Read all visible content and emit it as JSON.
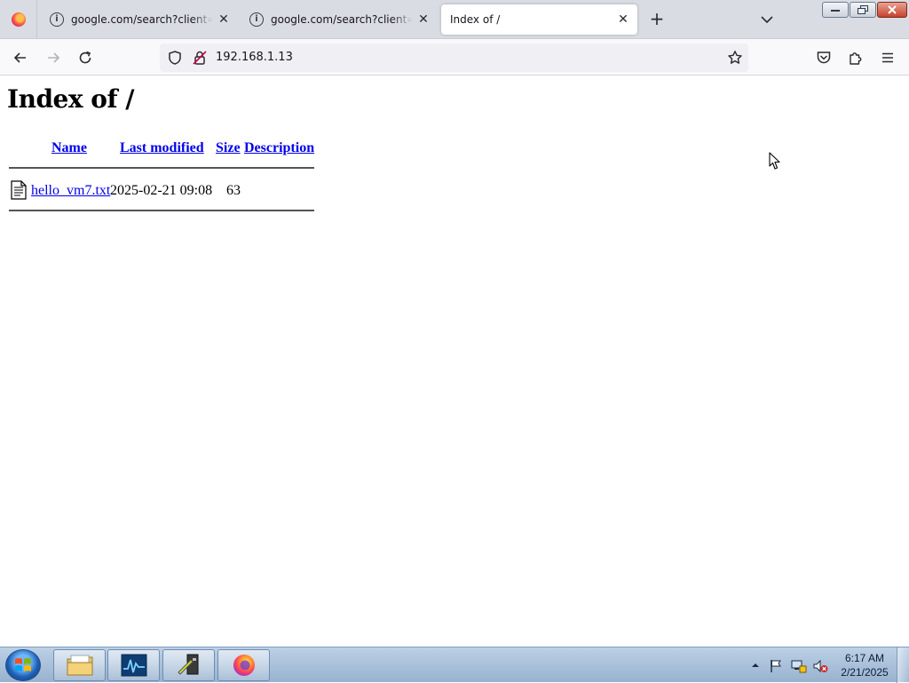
{
  "browser": {
    "tabs": [
      {
        "title": "google.com/search?client=firefox-b-d&q=",
        "active": false,
        "icon": "info-icon"
      },
      {
        "title": "google.com/search?client=firefox-b-d&q=",
        "active": false,
        "icon": "info-icon"
      },
      {
        "title": "Index of /",
        "active": true,
        "icon": ""
      }
    ],
    "new_tab_label": "+",
    "url": "192.168.1.13"
  },
  "page": {
    "title": "Index of /",
    "columns": {
      "name": "Name",
      "last_modified": "Last modified",
      "size": "Size",
      "description": "Description"
    },
    "files": [
      {
        "name": "hello_vm7.txt",
        "last_modified": "2025-02-21 09:08",
        "size": "63",
        "description": "",
        "icon": "text-file-icon"
      }
    ]
  },
  "taskbar": {
    "apps": [
      "file-explorer-icon",
      "resource-monitor-icon",
      "tools-app-icon",
      "firefox-icon"
    ],
    "clock": {
      "time": "6:17 AM",
      "date": "2/21/2025"
    },
    "tray": [
      "show-hidden-icons",
      "action-center-flag-icon",
      "network-icon",
      "volume-muted-icon"
    ]
  },
  "colors": {
    "link": "#0000ee",
    "tab_bar": "#d9dde3",
    "taskbar": "#a9c0db"
  }
}
